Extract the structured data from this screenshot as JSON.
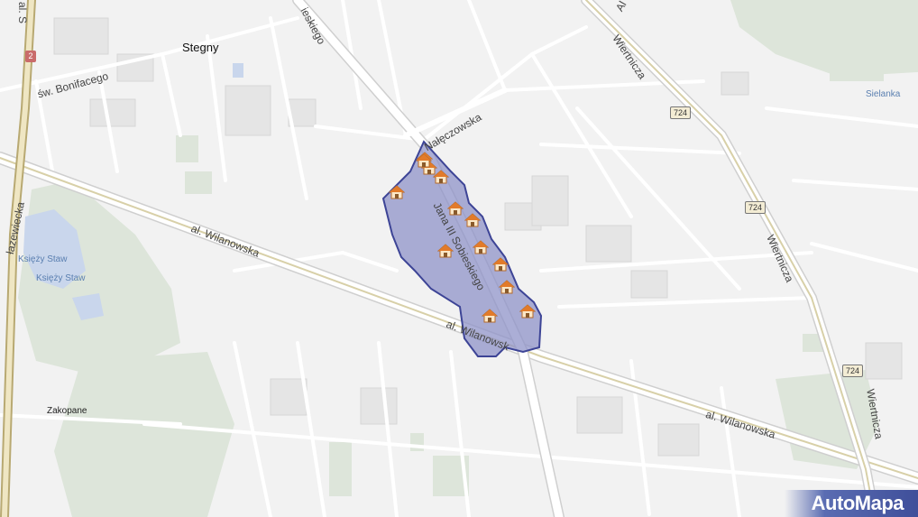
{
  "map": {
    "labels": {
      "stegny": "Stegny",
      "bonifacego": "św. Bonifacego",
      "naleczowska": "Nałęczowska",
      "sobieskiego_top": "ieskiego",
      "sobieskiego_main": "Jana III Sobieskiego",
      "wilanowska_left": "al. Wilanowska",
      "wilanowska_center": "al. Wilanowsk",
      "wilanowska_right": "al. Wilanowska",
      "wiertnicza_top": "Wiertnicza",
      "wiertnicza_mid": "Wiertnicza",
      "wiertnicza_bottom": "Wiertnicza",
      "ksiezy_staw_1": "Księży Staw",
      "ksiezy_staw_2": "Księży Staw",
      "sielanka": "Sielanka",
      "zakopane": "Zakopane",
      "al_s": "al. S",
      "lazewiecka": "łazewiecka",
      "al_top_right": "Al"
    },
    "road_shields": {
      "r724_a": "724",
      "r724_b": "724",
      "r724_c": "724",
      "r2": "2"
    },
    "markers": {
      "icon": "house-icon",
      "count": 13
    },
    "logo": "AutoMapa",
    "colors": {
      "area_fill": "#8f93c8",
      "area_stroke": "#3d4496",
      "road": "#ffffff",
      "tram": "#d8cc9a",
      "green": "#d9e3d6",
      "block": "#e4e4e4"
    }
  }
}
